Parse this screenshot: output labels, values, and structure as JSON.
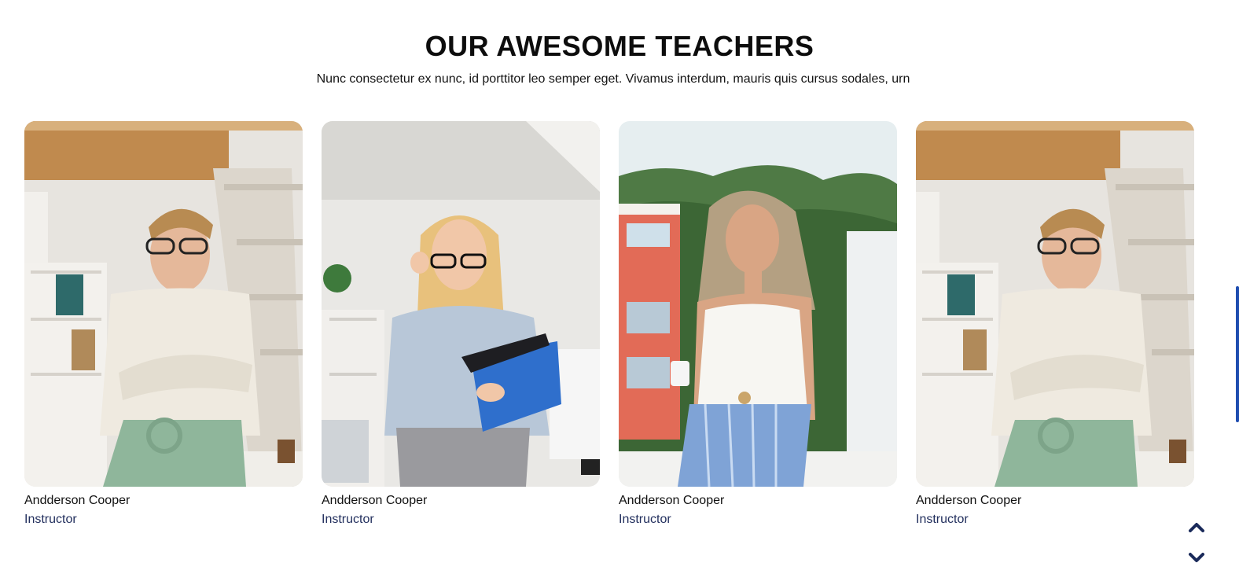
{
  "section": {
    "title": "OUR AWESOME TEACHERS",
    "subtitle": "Nunc consectetur ex nunc, id porttitor leo semper eget. Vivamus interdum, mauris quis cursus sodales, urn"
  },
  "teachers": [
    {
      "name": "Andderson Cooper",
      "role": "Instructor"
    },
    {
      "name": "Andderson Cooper",
      "role": "Instructor"
    },
    {
      "name": "Andderson Cooper",
      "role": "Instructor"
    },
    {
      "name": "Andderson Cooper",
      "role": "Instructor"
    }
  ],
  "nav": {
    "up_icon": "chevron-up-icon",
    "down_icon": "chevron-down-icon"
  },
  "colors": {
    "accent": "#1f4db0",
    "role_text": "#23305e",
    "nav_icon": "#1a2a5a"
  }
}
